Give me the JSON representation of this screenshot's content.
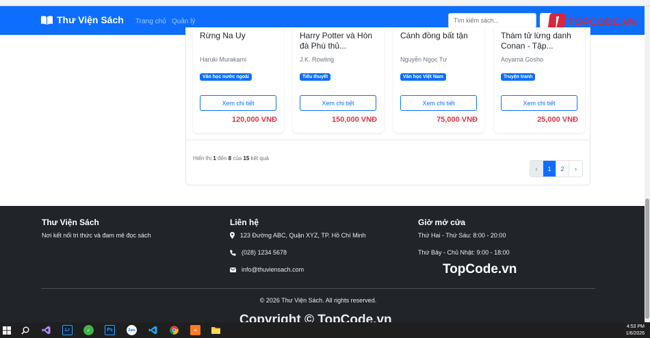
{
  "navbar": {
    "brand": "Thư Viện Sách",
    "links": [
      "Trang chủ",
      "Quản lý"
    ],
    "search_placeholder": "Tìm kiếm sách...",
    "search_button": "T"
  },
  "watermark": {
    "logo_text": "TOPCODE.VN",
    "mid_text": "TopCode.vn",
    "bottom_text": "Copyright © TopCode.vn"
  },
  "books": [
    {
      "title": "Rừng Na Uy",
      "author": "Haruki Murakami",
      "category": "Văn học nước ngoài",
      "button": "Xem chi tiết",
      "price": "120,000 VNĐ"
    },
    {
      "title": "Harry Potter và Hòn đá Phù thủ...",
      "author": "J.K. Rowling",
      "category": "Tiểu thuyết",
      "button": "Xem chi tiết",
      "price": "150,000 VNĐ"
    },
    {
      "title": "Cánh đồng bất tận",
      "author": "Nguyễn Ngọc Tư",
      "category": "Văn học Việt Nam",
      "button": "Xem chi tiết",
      "price": "75,000 VNĐ"
    },
    {
      "title": "Thám tử lừng danh Conan - Tập...",
      "author": "Aoyama Gosho",
      "category": "Truyện tranh",
      "button": "Xem chi tiết",
      "price": "25,000 VNĐ"
    }
  ],
  "results": {
    "prefix": "Hiển thị",
    "from": "1",
    "to_word": "đến",
    "to": "8",
    "of_word": "của",
    "total": "15",
    "suffix": "kết quả"
  },
  "pagination": {
    "prev": "‹",
    "pages": [
      "1",
      "2"
    ],
    "next": "›",
    "active": "1"
  },
  "footer": {
    "about_title": "Thư Viện Sách",
    "about_text": "Nơi kết nối tri thức và đam mê đọc sách",
    "contact_title": "Liên hệ",
    "address": "123 Đường ABC, Quận XYZ, TP. Hồ Chí Minh",
    "phone": "(028) 1234 5678",
    "email": "info@thuviensach.com",
    "hours_title": "Giờ mở cửa",
    "weekday_hours": "Thứ Hai - Thứ Sáu: 8:00 - 20:00",
    "weekend_hours": "Thứ Bảy - Chủ Nhật: 9:00 - 18:00",
    "copyright": "© 2026 Thư Viện Sách. All rights reserved."
  },
  "taskbar": {
    "time": "4:53 PM",
    "date": "1/6/2026"
  },
  "colors": {
    "primary": "#0d6efd",
    "price": "#dc3545",
    "footer_bg": "#212529"
  }
}
